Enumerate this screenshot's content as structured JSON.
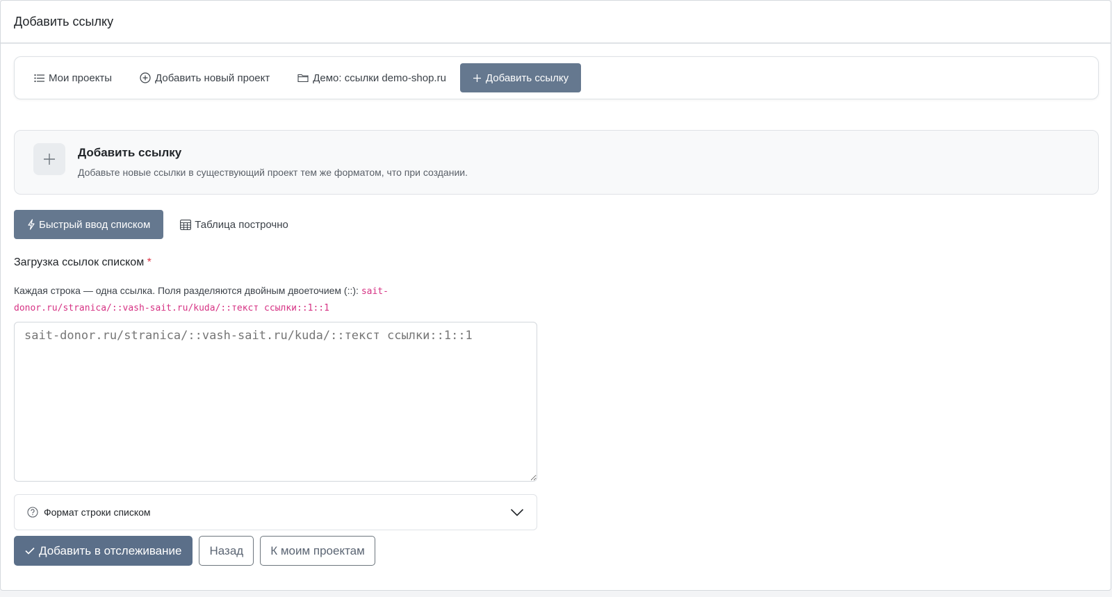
{
  "header": {
    "title": "Добавить ссылку"
  },
  "nav": {
    "items": [
      {
        "label": "Мои проекты",
        "icon": "list-icon"
      },
      {
        "label": "Добавить новый проект",
        "icon": "plus-circle-icon"
      },
      {
        "label": "Демо: ссылки demo-shop.ru",
        "icon": "folder-icon"
      },
      {
        "label": "Добавить ссылку",
        "icon": "plus-icon",
        "active": true
      }
    ]
  },
  "info": {
    "title": "Добавить ссылку",
    "description": "Добавьте новые ссылки в существующий проект тем же форматом, что при создании."
  },
  "modes": {
    "quick": "Быстрый ввод списком",
    "table": "Таблица построчно"
  },
  "field": {
    "label": "Загрузка ссылок списком",
    "required_mark": "*",
    "help": "Каждая строка — одна ссылка. Поля разделяются двойным двоеточием (::): ",
    "help_code": "sait-donor.ru/stranica/::vash-sait.ru/kuda/::текст ссылки::1::1",
    "placeholder": "sait-donor.ru/stranica/::vash-sait.ru/kuda/::текст ссылки::1::1"
  },
  "accordion": {
    "label": "Формат строки списком"
  },
  "actions": {
    "submit": "Добавить в отслеживание",
    "back": "Назад",
    "projects": "К моим проектам"
  },
  "colors": {
    "accent": "#65788f",
    "primary_button": "#5b6f89",
    "required": "#dc3545",
    "code": "#d63384"
  }
}
